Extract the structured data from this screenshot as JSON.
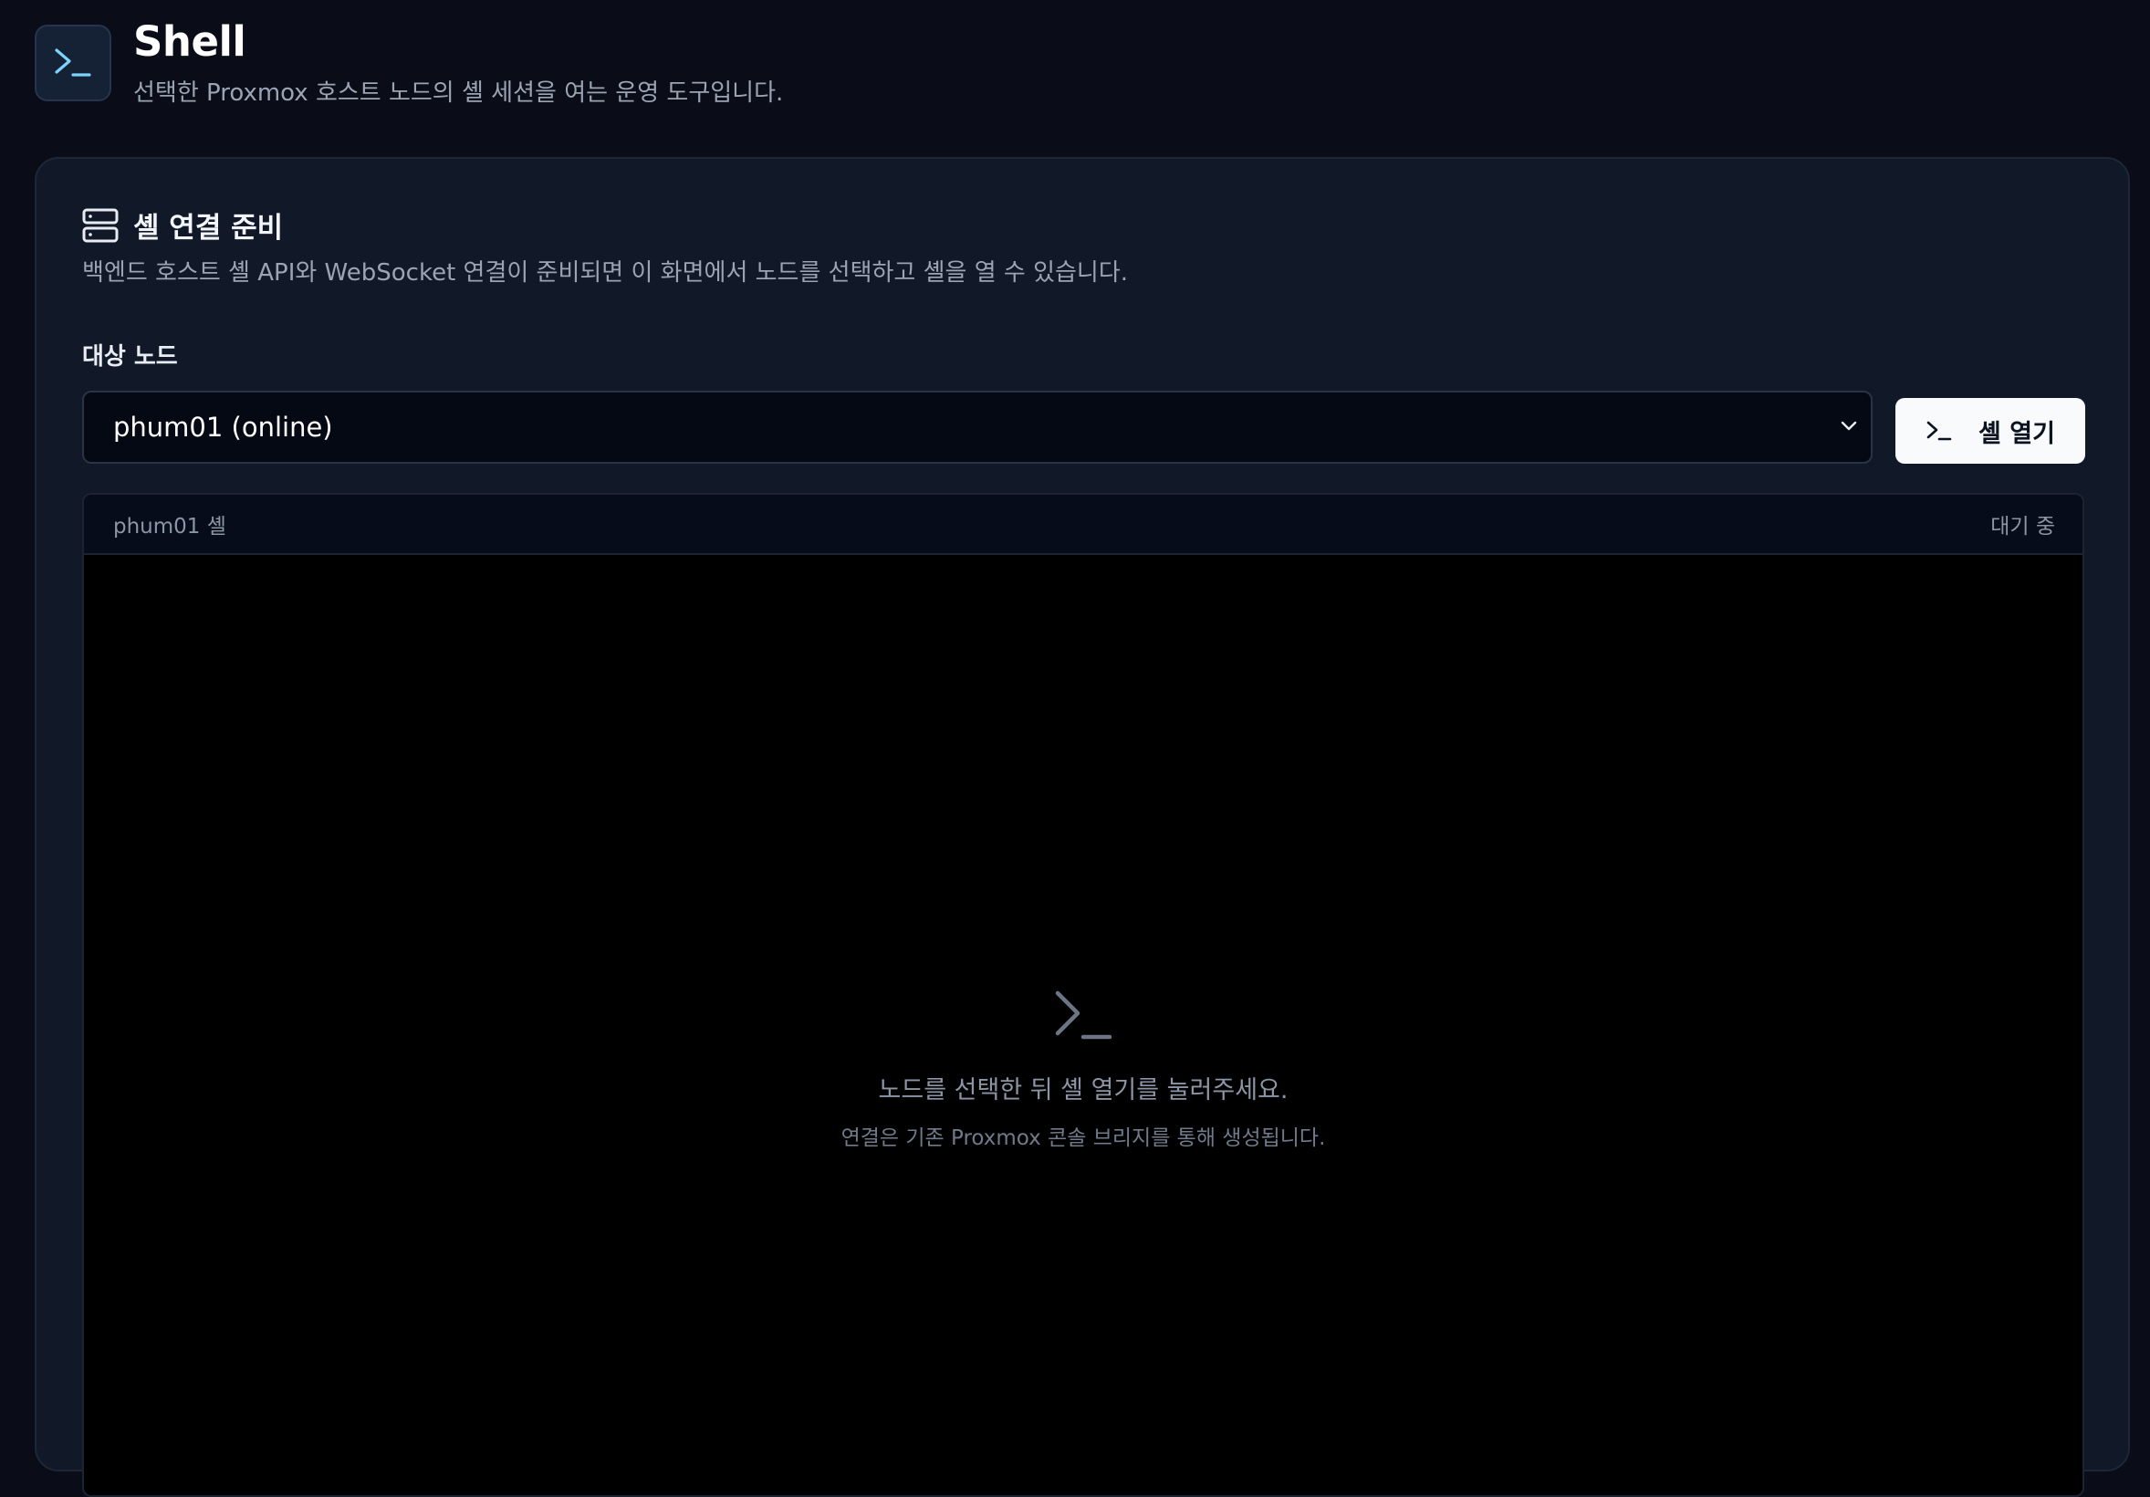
{
  "header": {
    "title": "Shell",
    "subtitle": "선택한 Proxmox 호스트 노드의 셸 세션을 여는 운영 도구입니다.",
    "icon": "terminal-icon"
  },
  "card": {
    "title": "셸 연결 준비",
    "title_icon": "server-icon",
    "description": "백엔드 호스트 셸 API와 WebSocket 연결이 준비되면 이 화면에서 노드를 선택하고 셸을 열 수 있습니다.",
    "node_label": "대상 노드",
    "node_select": {
      "selected": "phum01 (online)"
    },
    "open_button_label": "셸 열기"
  },
  "terminal": {
    "name": "phum01 셸",
    "status": "대기 중",
    "empty_title": "노드를 선택한 뒤 셸 열기를 눌러주세요.",
    "empty_subtitle": "연결은 기존 Proxmox 콘솔 브리지를 통해 생성됩니다."
  },
  "colors": {
    "background": "#0a0d17",
    "card": "#111828",
    "accent_icon": "#7dd3fc",
    "button": "#f8fafc"
  }
}
